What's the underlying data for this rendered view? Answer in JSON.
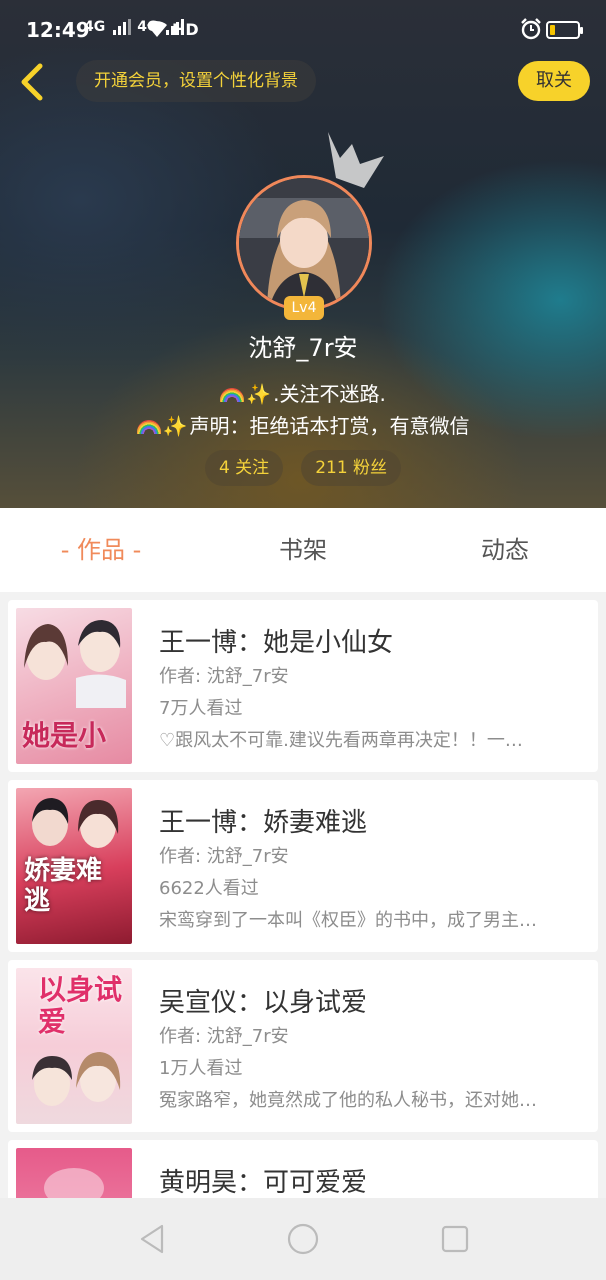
{
  "status_bar": {
    "time": "12:49",
    "network1": "4G",
    "network2": "4G",
    "hd": "HD"
  },
  "header": {
    "member_prompt": "开通会员，设置个性化背景",
    "unfollow_label": "取关",
    "level": "Lv4",
    "username": "沈舒_7r安",
    "bio_line1": ".关注不迷路.",
    "bio_line2": "声明：拒绝话本打赏，有意微信",
    "following": "4 关注",
    "fans": "211 粉丝"
  },
  "tabs": [
    {
      "label": "- 作品 -"
    },
    {
      "label": "书架"
    },
    {
      "label": "动态"
    }
  ],
  "works": [
    {
      "title": "王一博：她是小仙女",
      "author": "作者: 沈舒_7r安",
      "views": "7万人看过",
      "desc": "♡跟风太不可靠.建议先看两章再决定！！一…",
      "cover_text": "她是小"
    },
    {
      "title": "王一博：娇妻难逃",
      "author": "作者: 沈舒_7r安",
      "views": "6622人看过",
      "desc": "宋鸾穿到了一本叫《权臣》的书中，成了男主…",
      "cover_text": "娇妻难逃"
    },
    {
      "title": "吴宣仪：以身试爱",
      "author": "作者: 沈舒_7r安",
      "views": "1万人看过",
      "desc": "冤家路窄，她竟然成了他的私人秘书，还对她…",
      "cover_text": "以身试爱"
    },
    {
      "title": "黄明昊：可可爱爱",
      "author": "",
      "views": "",
      "desc": "",
      "cover_text": ""
    }
  ],
  "colors": {
    "accent_orange": "#f08a5a",
    "accent_yellow": "#f7d22a"
  }
}
